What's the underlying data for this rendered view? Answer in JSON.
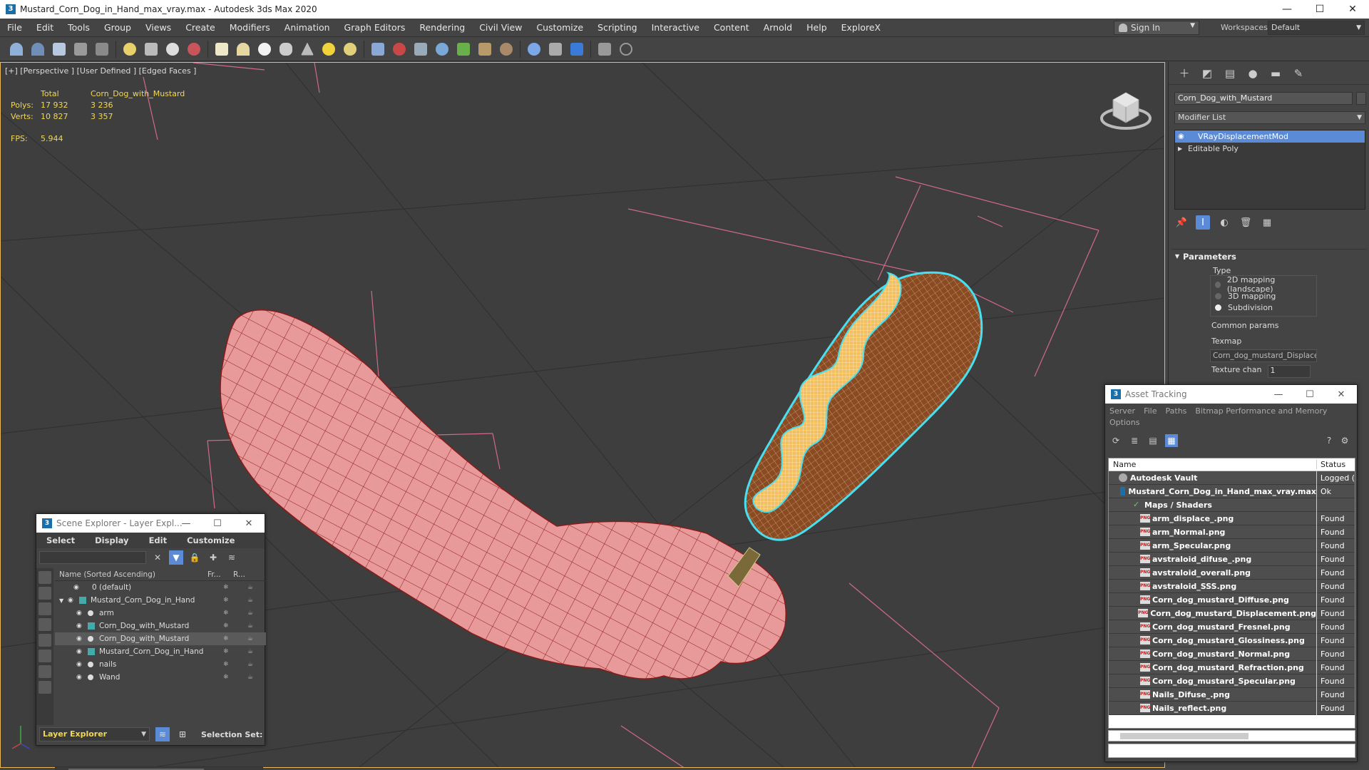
{
  "titlebar": {
    "app_icon": "3",
    "title": "Mustard_Corn_Dog_in_Hand_max_vray.max - Autodesk 3ds Max 2020",
    "minimize": "—",
    "maximize": "☐",
    "close": "✕"
  },
  "menu": {
    "items": [
      "File",
      "Edit",
      "Tools",
      "Group",
      "Views",
      "Create",
      "Modifiers",
      "Animation",
      "Graph Editors",
      "Rendering",
      "Civil View",
      "Customize",
      "Scripting",
      "Interactive",
      "Content",
      "Arnold",
      "Help",
      "ExploreX"
    ],
    "signin": "Sign In",
    "workspaces_label": "Workspaces:",
    "workspace": "Default"
  },
  "viewport": {
    "label": "[+] [Perspective ] [User Defined ] [Edged Faces ]",
    "stats_header": "Total",
    "object_name": "Corn_Dog_with_Mustard",
    "polys_label": "Polys:",
    "polys_total": "17 932",
    "polys_obj": "3 236",
    "verts_label": "Verts:",
    "verts_total": "10 827",
    "verts_obj": "3 357",
    "fps_label": "FPS:",
    "fps_value": "5.944"
  },
  "command_panel": {
    "object_name": "Corn_Dog_with_Mustard",
    "modifier_list": "Modifier List",
    "stack": [
      {
        "label": "VRayDisplacementMod",
        "selected": true
      },
      {
        "label": "Editable Poly",
        "selected": false
      }
    ],
    "rollout": "Parameters",
    "type_label": "Type",
    "type_options": [
      "2D mapping (landscape)",
      "3D mapping",
      "Subdivision"
    ],
    "type_selected": "Subdivision",
    "common_params": "Common params",
    "texmap_label": "Texmap",
    "texmap_value": "Corn_dog_mustard_Displacem",
    "texture_chan_label": "Texture chan",
    "texture_chan_value": "1"
  },
  "scene_explorer": {
    "title": "Scene Explorer - Layer Expl...",
    "menus": [
      "Select",
      "Display",
      "Edit",
      "Customize"
    ],
    "col_name": "Name (Sorted Ascending)",
    "col_fr": "Fr...",
    "col_r": "R...",
    "rows": [
      {
        "label": "0 (default)",
        "indent": 0,
        "type": "layer"
      },
      {
        "label": "Mustard_Corn_Dog_in_Hand",
        "indent": 0,
        "type": "layer-open"
      },
      {
        "label": "arm",
        "indent": 1,
        "type": "obj"
      },
      {
        "label": "Corn_Dog_with_Mustard",
        "indent": 1,
        "type": "obj"
      },
      {
        "label": "Corn_Dog_with_Mustard",
        "indent": 1,
        "type": "obj",
        "highlight": true
      },
      {
        "label": "Mustard_Corn_Dog_in_Hand",
        "indent": 1,
        "type": "obj"
      },
      {
        "label": "nails",
        "indent": 1,
        "type": "obj"
      },
      {
        "label": "Wand",
        "indent": 1,
        "type": "obj"
      }
    ],
    "footer_layer": "Layer Explorer",
    "selection_set": "Selection Set:"
  },
  "asset_tracking": {
    "title": "Asset Tracking",
    "menus": [
      "Server",
      "File",
      "Paths",
      "Bitmap Performance and Memory"
    ],
    "menu2": "Options",
    "col_name": "Name",
    "col_status": "Status",
    "rows": [
      {
        "name": "Autodesk Vault",
        "status": "Logged (",
        "icon": "vault",
        "indent": 1
      },
      {
        "name": "Mustard_Corn_Dog_in_Hand_max_vray.max",
        "status": "Ok",
        "icon": "max",
        "indent": 2
      },
      {
        "name": "Maps / Shaders",
        "status": "",
        "icon": "shader",
        "indent": 3
      },
      {
        "name": "arm_displace_.png",
        "status": "Found",
        "icon": "png",
        "indent": 4
      },
      {
        "name": "arm_Normal.png",
        "status": "Found",
        "icon": "png",
        "indent": 4
      },
      {
        "name": "arm_Specular.png",
        "status": "Found",
        "icon": "png",
        "indent": 4
      },
      {
        "name": "avstraloid_difuse_.png",
        "status": "Found",
        "icon": "png",
        "indent": 4
      },
      {
        "name": "avstraloid_overall.png",
        "status": "Found",
        "icon": "png",
        "indent": 4
      },
      {
        "name": "avstraloid_SSS.png",
        "status": "Found",
        "icon": "png",
        "indent": 4
      },
      {
        "name": "Corn_dog_mustard_Diffuse.png",
        "status": "Found",
        "icon": "png",
        "indent": 4
      },
      {
        "name": "Corn_dog_mustard_Displacement.png",
        "status": "Found",
        "icon": "png",
        "indent": 4
      },
      {
        "name": "Corn_dog_mustard_Fresnel.png",
        "status": "Found",
        "icon": "png",
        "indent": 4
      },
      {
        "name": "Corn_dog_mustard_Glossiness.png",
        "status": "Found",
        "icon": "png",
        "indent": 4
      },
      {
        "name": "Corn_dog_mustard_Normal.png",
        "status": "Found",
        "icon": "png",
        "indent": 4
      },
      {
        "name": "Corn_dog_mustard_Refraction.png",
        "status": "Found",
        "icon": "png",
        "indent": 4
      },
      {
        "name": "Corn_dog_mustard_Specular.png",
        "status": "Found",
        "icon": "png",
        "indent": 4
      },
      {
        "name": "Nails_Difuse_.png",
        "status": "Found",
        "icon": "png",
        "indent": 4
      },
      {
        "name": "Nails_reflect.png",
        "status": "Found",
        "icon": "png",
        "indent": 4
      }
    ]
  },
  "colors": {
    "accent": "#5b8ad6",
    "stats_yellow": "#f0d85a",
    "viewport_border": "#e8b85a",
    "mesh_skin": "#e89a9a",
    "mesh_wire": "#8b1a1a",
    "selection_cyan": "#48e0f0"
  }
}
